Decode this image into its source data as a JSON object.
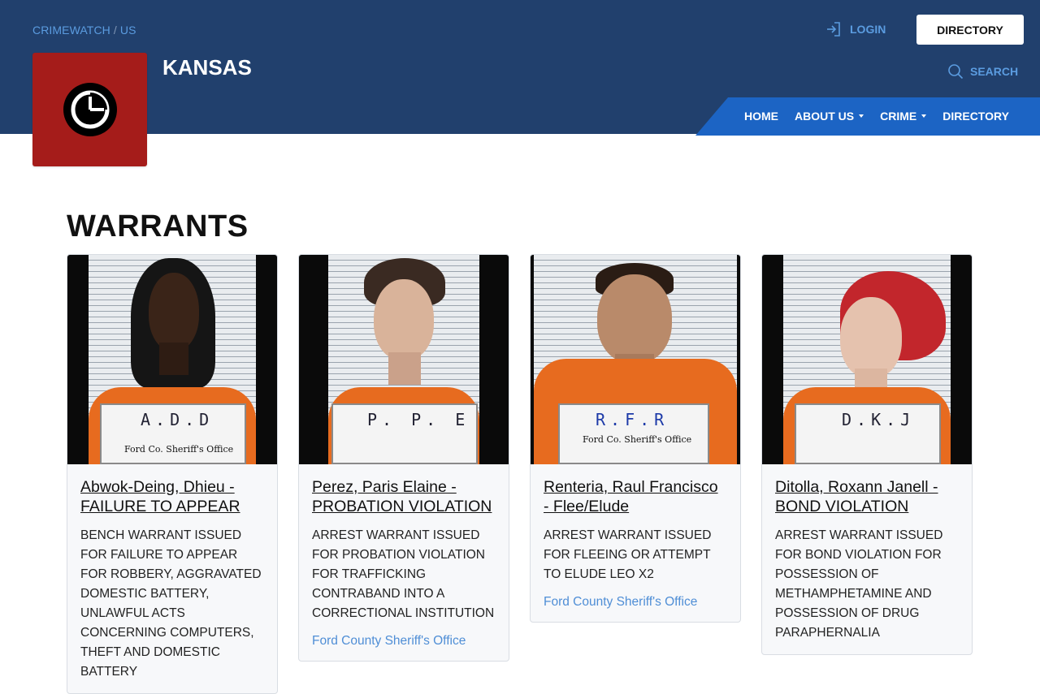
{
  "header": {
    "breadcrumb": [
      "CRIMEWATCH",
      "US"
    ],
    "breadcrumb_sep": "/",
    "login_label": "LOGIN",
    "directory_button": "DIRECTORY",
    "search_label": "SEARCH",
    "site_title": "KANSAS",
    "logo_icon": "crimewatch-logo-icon",
    "colors": {
      "header_bg": "#21406d",
      "nav_bg": "#1c64c4",
      "logo_bg": "#a51c1a",
      "link": "#5b9ce0"
    }
  },
  "nav": {
    "items": [
      {
        "label": "HOME",
        "dropdown": false
      },
      {
        "label": "ABOUT US",
        "dropdown": true
      },
      {
        "label": "CRIME",
        "dropdown": true
      },
      {
        "label": "DIRECTORY",
        "dropdown": false
      }
    ]
  },
  "page": {
    "heading": "WARRANTS"
  },
  "cards": [
    {
      "title": "Abwok-Deing, Dhieu - FAILURE TO APPEAR",
      "description": "BENCH WARRANT ISSUED FOR FAILURE TO APPEAR FOR ROBBERY, AGGRAVATED DOMESTIC BATTERY, UNLAWFUL ACTS CONCERNING COMPUTERS, THEFT AND DOMESTIC BATTERY",
      "agency": "",
      "placard_initials": "A.D.D",
      "placard_office": "Ford Co. Sheriff's Office"
    },
    {
      "title": "Perez, Paris Elaine - PROBATION VIOLATION",
      "description": "ARREST WARRANT ISSUED FOR PROBATION VIOLATION FOR TRAFFICKING CONTRABAND INTO A CORRECTIONAL INSTITUTION",
      "agency": "Ford County Sheriff's Office",
      "placard_initials": "P. P. E",
      "placard_office": ""
    },
    {
      "title": "Renteria, Raul Francisco - Flee/Elude",
      "description": "ARREST WARRANT ISSUED FOR FLEEING OR ATTEMPT TO ELUDE LEO X2",
      "agency": "Ford County Sheriff's Office",
      "placard_initials": "R.F.R",
      "placard_office": "Ford Co. Sheriff's Office"
    },
    {
      "title": "Ditolla, Roxann Janell - BOND VIOLATION",
      "description": "ARREST WARRANT ISSUED FOR BOND VIOLATION FOR POSSESSION OF METHAMPHETAMINE AND POSSESSION OF DRUG PARAPHERNALIA",
      "agency": "",
      "placard_initials": "D.K.J",
      "placard_office": ""
    }
  ]
}
